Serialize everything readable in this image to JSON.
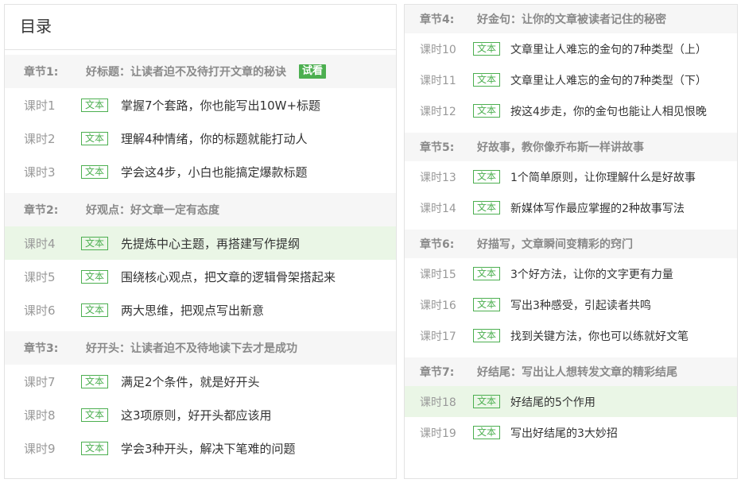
{
  "catalog": {
    "title": "目录",
    "lesson_tag": "文本",
    "trial_badge": "试看",
    "chapters": [
      {
        "no": "章节1:",
        "title": "好标题：让读者迫不及待打开文章的秘诀",
        "lessons": [
          {
            "no": "课时1",
            "title": "掌握7个套路，你也能写出10W+标题"
          },
          {
            "no": "课时2",
            "title": "理解4种情绪，你的标题就能打动人"
          },
          {
            "no": "课时3",
            "title": "学会这4步，小白也能搞定爆款标题"
          }
        ]
      },
      {
        "no": "章节2:",
        "title": "好观点：好文章一定有态度",
        "lessons": [
          {
            "no": "课时4",
            "title": "先提炼中心主题，再搭建写作提纲"
          },
          {
            "no": "课时5",
            "title": "围绕核心观点，把文章的逻辑骨架搭起来"
          },
          {
            "no": "课时6",
            "title": "两大思维，把观点写出新意"
          }
        ]
      },
      {
        "no": "章节3:",
        "title": "好开头：让读者迫不及待地读下去才是成功",
        "lessons": [
          {
            "no": "课时7",
            "title": "满足2个条件，就是好开头"
          },
          {
            "no": "课时8",
            "title": "这3项原则，好开头都应该用"
          },
          {
            "no": "课时9",
            "title": "学会3种开头，解决下笔难的问题"
          }
        ]
      },
      {
        "no": "章节4:",
        "title": "好金句：让你的文章被读者记住的秘密",
        "lessons": [
          {
            "no": "课时10",
            "title": " 文章里让人难忘的金句的7种类型（上）"
          },
          {
            "no": "课时11",
            "title": "文章里让人难忘的金句的7种类型（下）"
          },
          {
            "no": "课时12",
            "title": "按这4步走，你的金句也能让人相见恨晚"
          }
        ]
      },
      {
        "no": "章节5:",
        "title": "好故事，教你像乔布斯一样讲故事",
        "lessons": [
          {
            "no": "课时13",
            "title": "1个简单原则，让你理解什么是好故事"
          },
          {
            "no": "课时14",
            "title": " 新媒体写作最应掌握的2种故事写法"
          }
        ]
      },
      {
        "no": "章节6:",
        "title": "好描写，文章瞬间变精彩的窍门",
        "lessons": [
          {
            "no": "课时15",
            "title": "3个好方法，让你的文字更有力量"
          },
          {
            "no": "课时16",
            "title": "写出3种感受，引起读者共鸣"
          },
          {
            "no": "课时17",
            "title": "找到关键方法，你也可以练就好文笔"
          }
        ]
      },
      {
        "no": "章节7:",
        "title": "好结尾：写出让人想转发文章的精彩结尾",
        "lessons": [
          {
            "no": "课时18",
            "title": "好结尾的5个作用"
          },
          {
            "no": "课时19",
            "title": "写出好结尾的3大妙招"
          }
        ]
      }
    ]
  },
  "colors": {
    "accent_green": "#4caf50",
    "active_row_bg": "#eaf6e6",
    "chapter_bg": "#f6f6f6"
  }
}
